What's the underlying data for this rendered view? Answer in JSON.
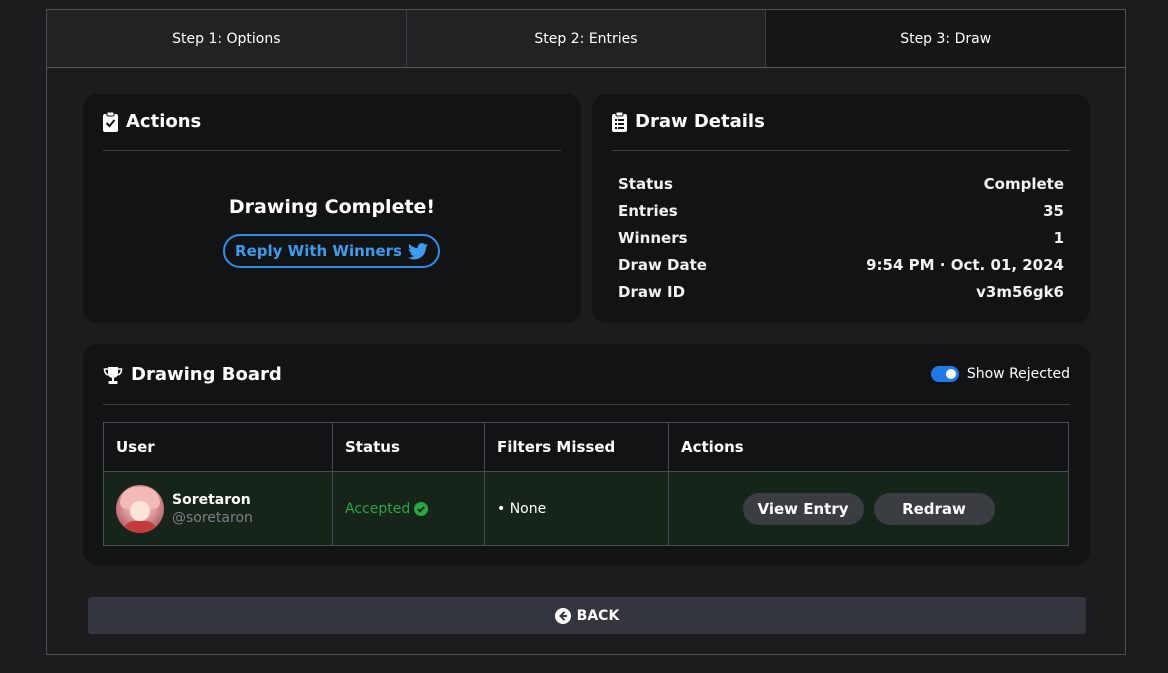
{
  "tabs": [
    {
      "label": "Step 1: Options"
    },
    {
      "label": "Step 2: Entries"
    },
    {
      "label": "Step 3: Draw"
    }
  ],
  "actions": {
    "title": "Actions",
    "complete_text": "Drawing Complete!",
    "reply_button": "Reply With Winners",
    "icon": "clipboard-check-icon"
  },
  "details": {
    "title": "Draw Details",
    "icon": "clipboard-list-icon",
    "rows": [
      {
        "label": "Status",
        "value": "Complete"
      },
      {
        "label": "Entries",
        "value": "35"
      },
      {
        "label": "Winners",
        "value": "1"
      },
      {
        "label": "Draw Date",
        "value": "9:54 PM · Oct. 01, 2024"
      },
      {
        "label": "Draw ID",
        "value": "v3m56gk6"
      }
    ]
  },
  "board": {
    "title": "Drawing Board",
    "icon": "trophy-icon",
    "toggle_label": "Show Rejected",
    "toggle_on": true,
    "columns": [
      "User",
      "Status",
      "Filters Missed",
      "Actions"
    ],
    "rows": [
      {
        "name": "Soretaron",
        "handle": "@soretaron",
        "status": "Accepted",
        "filters": "• None",
        "view_label": "View Entry",
        "redraw_label": "Redraw"
      }
    ]
  },
  "back_label": "BACK",
  "colors": {
    "accent": "#1f7ae6",
    "twitter": "#3d9bf0",
    "accepted": "#28a745",
    "card": "#121314",
    "background": "#1b1c1e"
  }
}
